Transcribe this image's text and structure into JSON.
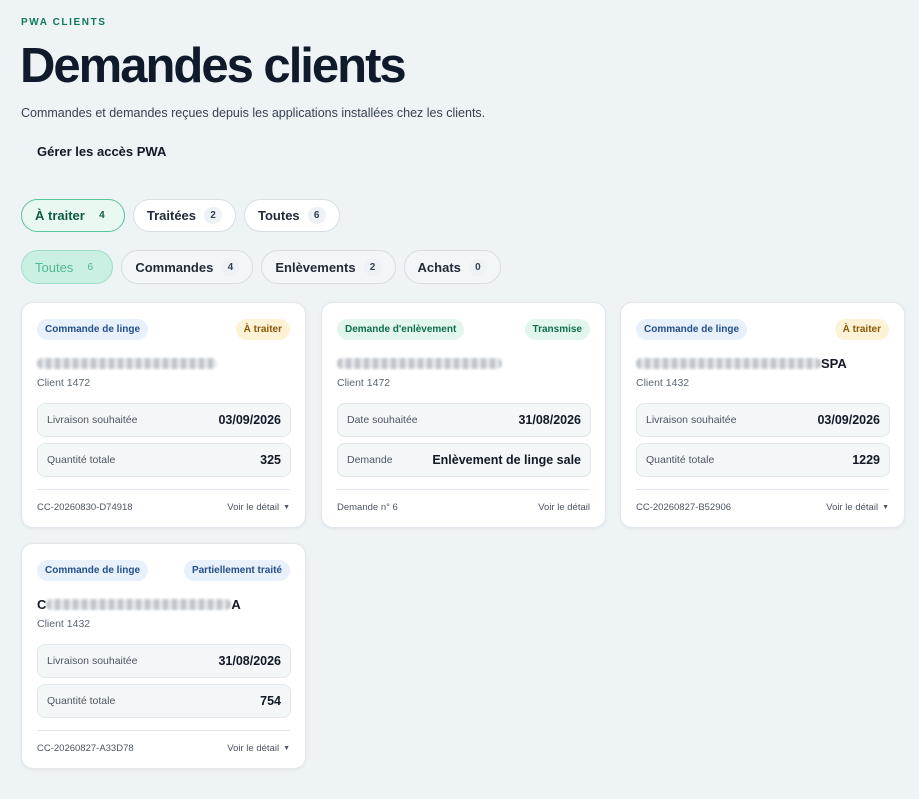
{
  "header": {
    "eyebrow": "PWA CLIENTS",
    "title": "Demandes clients",
    "subtitle": "Commandes et demandes reçues depuis les applications installées chez les clients.",
    "manage_link": "Gérer les accès PWA"
  },
  "status_filters": [
    {
      "label": "À traiter",
      "count": "4",
      "active": true
    },
    {
      "label": "Traitées",
      "count": "2",
      "active": false
    },
    {
      "label": "Toutes",
      "count": "6",
      "active": false
    }
  ],
  "type_filters": [
    {
      "label": "Toutes",
      "count": "6",
      "active": true
    },
    {
      "label": "Commandes",
      "count": "4",
      "active": false
    },
    {
      "label": "Enlèvements",
      "count": "2",
      "active": false
    },
    {
      "label": "Achats",
      "count": "0",
      "active": false
    }
  ],
  "cards": [
    {
      "type_badge": "Commande de linge",
      "status_badge": "À traiter",
      "name_prefix": "",
      "name_suffix": "",
      "client": "Client 1472",
      "field1_label": "Livraison souhaitée",
      "field1_value": "03/09/2026",
      "field2_label": "Quantité totale",
      "field2_value": "325",
      "ref": "CC-20260830-D74918",
      "detail": "Voir le détail"
    },
    {
      "type_badge": "Demande d'enlèvement",
      "status_badge": "Transmise",
      "name_prefix": "",
      "name_suffix": "",
      "client": "Client 1472",
      "field1_label": "Date souhaitée",
      "field1_value": "31/08/2026",
      "field2_label": "Demande",
      "field2_value": "Enlèvement de linge sale",
      "ref": "Demande n° 6",
      "detail": "Voir le détail"
    },
    {
      "type_badge": "Commande de linge",
      "status_badge": "À traiter",
      "name_prefix": "",
      "name_suffix": "SPA",
      "client": "Client 1432",
      "field1_label": "Livraison souhaitée",
      "field1_value": "03/09/2026",
      "field2_label": "Quantité totale",
      "field2_value": "1229",
      "ref": "CC-20260827-B52906",
      "detail": "Voir le détail"
    },
    {
      "type_badge": "Commande de linge",
      "status_badge": "Partiellement traité",
      "name_prefix": "C",
      "name_suffix": "A",
      "client": "Client 1432",
      "field1_label": "Livraison souhaitée",
      "field1_value": "31/08/2026",
      "field2_label": "Quantité totale",
      "field2_value": "754",
      "ref": "CC-20260827-A33D78",
      "detail": "Voir le détail"
    }
  ],
  "colors": {
    "accent_green": "#0f7a5a",
    "active_pill_bg": "#e9f8f1",
    "badge_blue": "#e8f0fb",
    "badge_yellow": "#fdf1d6",
    "badge_green": "#e3f6ee"
  }
}
